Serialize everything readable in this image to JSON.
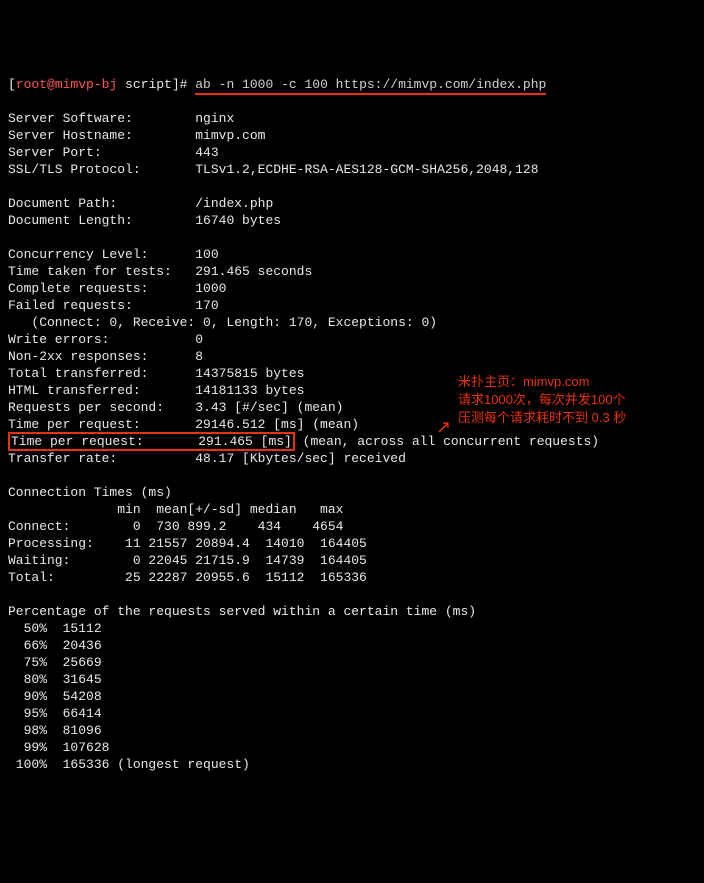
{
  "prompt": {
    "bracket_open": "[",
    "user_host": "root@mimvp-bj",
    "path": " script",
    "bracket_close": "]# ",
    "command": "ab -n 1000 -c 100 https://mimvp.com/index.php"
  },
  "server": {
    "software_label": "Server Software:        ",
    "software": "nginx",
    "hostname_label": "Server Hostname:        ",
    "hostname": "mimvp.com",
    "port_label": "Server Port:            ",
    "port": "443",
    "ssl_label": "SSL/TLS Protocol:       ",
    "ssl": "TLSv1.2,ECDHE-RSA-AES128-GCM-SHA256,2048,128"
  },
  "doc": {
    "path_label": "Document Path:          ",
    "path": "/index.php",
    "len_label": "Document Length:        ",
    "len": "16740 bytes"
  },
  "run": {
    "conc_label": "Concurrency Level:      ",
    "conc": "100",
    "time_label": "Time taken for tests:   ",
    "time": "291.465 seconds",
    "complete_label": "Complete requests:      ",
    "complete": "1000",
    "failed_label": "Failed requests:        ",
    "failed": "170",
    "failed_detail": "   (Connect: 0, Receive: 0, Length: 170, Exceptions: 0)",
    "write_label": "Write errors:           ",
    "write": "0",
    "non2xx_label": "Non-2xx responses:      ",
    "non2xx": "8",
    "tot_label": "Total transferred:      ",
    "tot": "14375815 bytes",
    "html_label": "HTML transferred:       ",
    "html": "14181133 bytes",
    "rps_label": "Requests per second:    ",
    "rps": "3.43 [#/sec] (mean)",
    "tpr1_label": "Time per request:       ",
    "tpr1": "29146.512 [ms] (mean)",
    "tpr2_label": "Time per request:       ",
    "tpr2_val": "291.465 [ms]",
    "tpr2_suffix": " (mean, across all concurrent requests)",
    "rate_label": "Transfer rate:          ",
    "rate": "48.17 [Kbytes/sec] received"
  },
  "conn": {
    "title": "Connection Times (ms)",
    "header": "              min  mean[+/-sd] median   max",
    "rows": [
      "Connect:        0  730 899.2    434    4654",
      "Processing:    11 21557 20894.4  14010  164405",
      "Waiting:        0 22045 21715.9  14739  164405",
      "Total:         25 22287 20955.6  15112  165336"
    ]
  },
  "pct": {
    "title": "Percentage of the requests served within a certain time (ms)",
    "rows": [
      "  50%  15112",
      "  66%  20436",
      "  75%  25669",
      "  80%  31645",
      "  90%  54208",
      "  95%  66414",
      "  98%  81096",
      "  99%  107628",
      " 100%  165336 (longest request)"
    ]
  },
  "annotation": {
    "line1": "米扑主页：mimvp.com",
    "line2": "请求1000次，每次并发100个",
    "line3": "压测每个请求耗时不到 0.3 秒",
    "arrow": "↗"
  },
  "chart_data": {
    "type": "table",
    "title": "ApacheBench result for https://mimvp.com/index.php",
    "request_count": 1000,
    "concurrency": 100,
    "time_taken_sec": 291.465,
    "failed_requests": 170,
    "non_2xx": 8,
    "total_transferred_bytes": 14375815,
    "html_transferred_bytes": 14181133,
    "requests_per_second": 3.43,
    "time_per_request_ms_mean": 29146.512,
    "time_per_request_ms_across": 291.465,
    "transfer_rate_kbps": 48.17,
    "connection_times_ms": {
      "columns": [
        "min",
        "mean",
        "sd",
        "median",
        "max"
      ],
      "Connect": [
        0,
        730,
        899.2,
        434,
        4654
      ],
      "Processing": [
        11,
        21557,
        20894.4,
        14010,
        164405
      ],
      "Waiting": [
        0,
        22045,
        21715.9,
        14739,
        164405
      ],
      "Total": [
        25,
        22287,
        20955.6,
        15112,
        165336
      ]
    },
    "percentiles_ms": {
      "50": 15112,
      "66": 20436,
      "75": 25669,
      "80": 31645,
      "90": 54208,
      "95": 66414,
      "98": 81096,
      "99": 107628,
      "100": 165336
    }
  }
}
